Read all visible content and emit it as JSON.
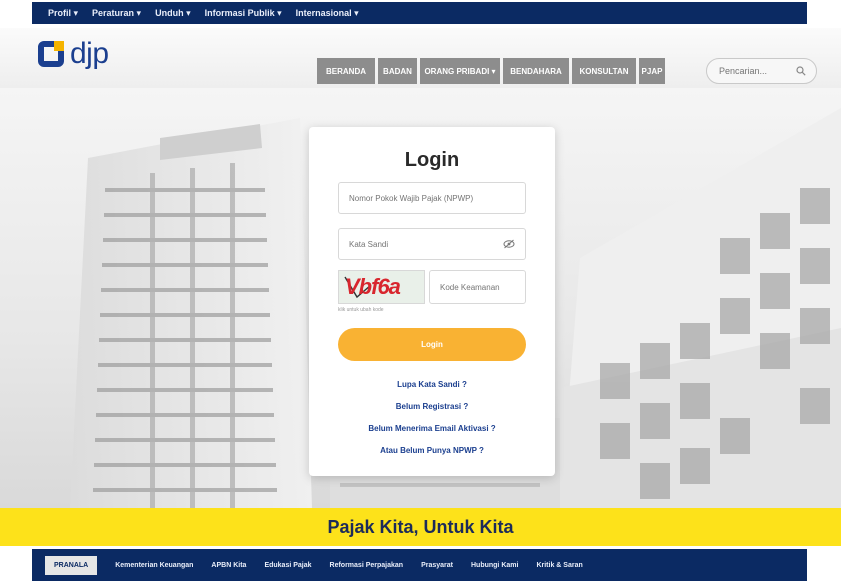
{
  "top_nav": [
    {
      "label": "Profil ▾"
    },
    {
      "label": "Peraturan ▾"
    },
    {
      "label": "Unduh ▾"
    },
    {
      "label": "Informasi Publik ▾"
    },
    {
      "label": "Internasional ▾"
    }
  ],
  "logo": {
    "text": "djp"
  },
  "main_nav": [
    {
      "label": "BERANDA"
    },
    {
      "label": "BADAN"
    },
    {
      "label": "ORANG PRIBADI ▾"
    },
    {
      "label": "BENDAHARA"
    },
    {
      "label": "KONSULTAN"
    },
    {
      "label": "PJAP"
    }
  ],
  "search": {
    "placeholder": "Pencarian..."
  },
  "login": {
    "title": "Login",
    "npwp_placeholder": "Nomor Pokok Wajib Pajak (NPWP)",
    "password_placeholder": "Kata Sandi",
    "captcha_text": "Vbf6a",
    "captcha_placeholder": "Kode Keamanan",
    "captcha_hint": "klik untuk ubah kode",
    "button": "Login",
    "links": [
      {
        "label": "Lupa Kata Sandi ?"
      },
      {
        "label": "Belum Registrasi ?"
      },
      {
        "label": "Belum Menerima Email Aktivasi ?"
      },
      {
        "label": "Atau Belum Punya NPWP ?"
      }
    ]
  },
  "tagline": "Pajak Kita, Untuk Kita",
  "footer_nav": [
    {
      "label": "PRANALA"
    },
    {
      "label": "Kementerian Keuangan"
    },
    {
      "label": "APBN Kita"
    },
    {
      "label": "Edukasi Pajak"
    },
    {
      "label": "Reformasi Perpajakan"
    },
    {
      "label": "Prasyarat"
    },
    {
      "label": "Hubungi Kami"
    },
    {
      "label": "Kritik & Saran"
    }
  ],
  "colors": {
    "navy": "#0b2a63",
    "brand_blue": "#1b3f8f",
    "accent_yellow": "#fde21a",
    "button_orange": "#f9b233",
    "nav_gray": "#8d8d8d"
  }
}
